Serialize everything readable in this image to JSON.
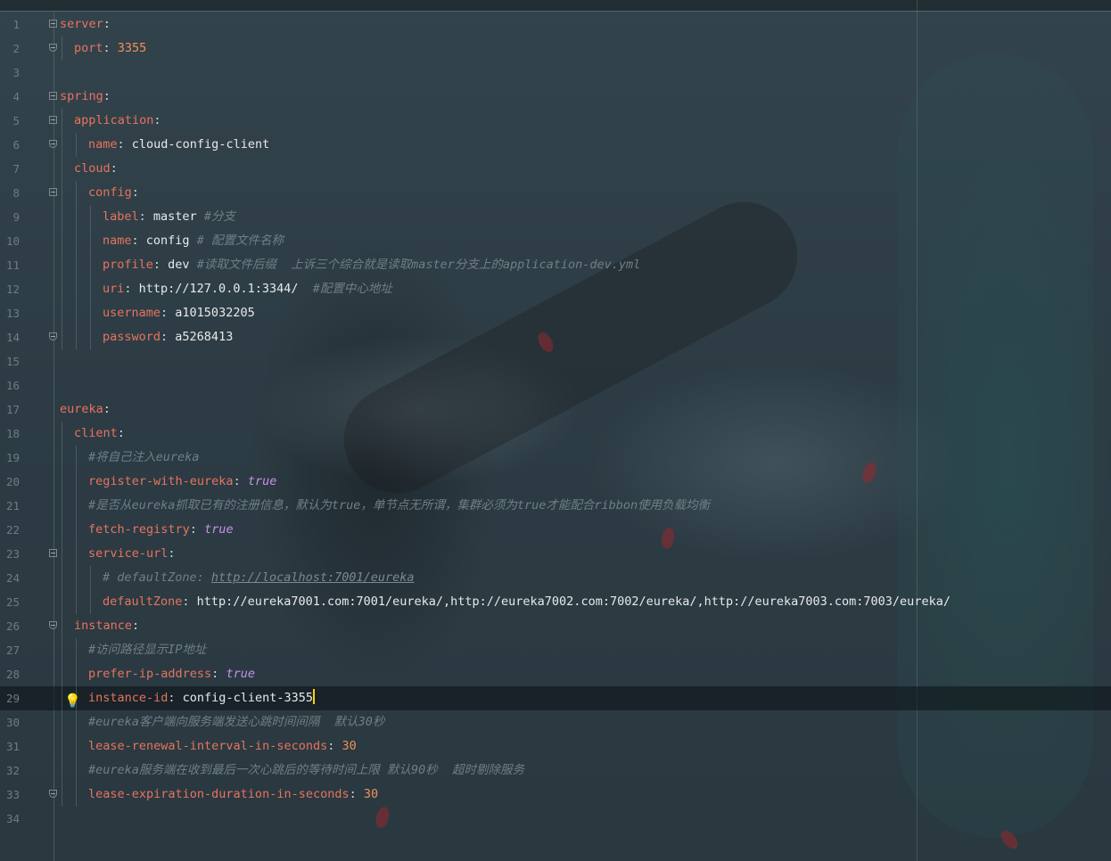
{
  "editor": {
    "language": "yaml",
    "current_line": 29,
    "colors": {
      "key": "#e8735f",
      "value": "#e6eaec",
      "number": "#f0915a",
      "boolean": "#c792ea",
      "comment": "#6f7f86",
      "caret": "#ffd400"
    },
    "lines": [
      {
        "n": "1",
        "key": "server",
        "sep": ":"
      },
      {
        "n": "2",
        "key": "port",
        "sep": ": ",
        "num": "3355"
      },
      {
        "n": "3"
      },
      {
        "n": "4",
        "key": "spring",
        "sep": ":"
      },
      {
        "n": "5",
        "key": "application",
        "sep": ":"
      },
      {
        "n": "6",
        "key": "name",
        "sep": ": ",
        "val": "cloud-config-client"
      },
      {
        "n": "7",
        "key": "cloud",
        "sep": ":"
      },
      {
        "n": "8",
        "key": "config",
        "sep": ":"
      },
      {
        "n": "9",
        "key": "label",
        "sep": ": ",
        "val": "master ",
        "cmt": "#分支"
      },
      {
        "n": "10",
        "key": "name",
        "sep": ": ",
        "val": "config ",
        "cmt": "# 配置文件名称"
      },
      {
        "n": "11",
        "key": "profile",
        "sep": ": ",
        "val": "dev ",
        "cmt": "#读取文件后缀  上诉三个综合就是读取master分支上的application-dev.yml"
      },
      {
        "n": "12",
        "key": "uri",
        "sep": ": ",
        "val": "http://127.0.0.1:3344/  ",
        "cmt": "#配置中心地址"
      },
      {
        "n": "13",
        "key": "username",
        "sep": ": ",
        "val": "a1015032205"
      },
      {
        "n": "14",
        "key": "password",
        "sep": ": ",
        "val": "a5268413"
      },
      {
        "n": "15"
      },
      {
        "n": "16"
      },
      {
        "n": "17",
        "key": "eureka",
        "sep": ":"
      },
      {
        "n": "18",
        "key": "client",
        "sep": ":"
      },
      {
        "n": "19",
        "cmt": "#将自己注入eureka"
      },
      {
        "n": "20",
        "key": "register-with-eureka",
        "sep": ": ",
        "bool": "true"
      },
      {
        "n": "21",
        "cmt": "#是否从eureka抓取已有的注册信息，默认为true，单节点无所谓，集群必须为true才能配合ribbon使用负载均衡"
      },
      {
        "n": "22",
        "key": "fetch-registry",
        "sep": ": ",
        "bool": "true"
      },
      {
        "n": "23",
        "key": "service-url",
        "sep": ":"
      },
      {
        "n": "24",
        "cmt": "# defaultZone: ",
        "cmt_url": "http://localhost:7001/eureka"
      },
      {
        "n": "25",
        "key": "defaultZone",
        "sep": ": ",
        "val": "http://eureka7001.com:7001/eureka/,http://eureka7002.com:7002/eureka/,http://eureka7003.com:7003/eureka/"
      },
      {
        "n": "26",
        "key": "instance",
        "sep": ":"
      },
      {
        "n": "27",
        "cmt": "#访问路径显示IP地址"
      },
      {
        "n": "28",
        "key": "prefer-ip-address",
        "sep": ": ",
        "bool": "true"
      },
      {
        "n": "29",
        "key": "instance-id",
        "sep": ": ",
        "val": "config-client-3355"
      },
      {
        "n": "30",
        "cmt": "#eureka客户端向服务端发送心跳时间间隔  默认30秒"
      },
      {
        "n": "31",
        "key": "lease-renewal-interval-in-seconds",
        "sep": ": ",
        "num": "30"
      },
      {
        "n": "32",
        "cmt": "#eureka服务端在收到最后一次心跳后的等待时间上限 默认90秒  超时剔除服务"
      },
      {
        "n": "33",
        "key": "lease-expiration-duration-in-seconds",
        "sep": ": ",
        "num": "30"
      },
      {
        "n": "34"
      }
    ]
  }
}
